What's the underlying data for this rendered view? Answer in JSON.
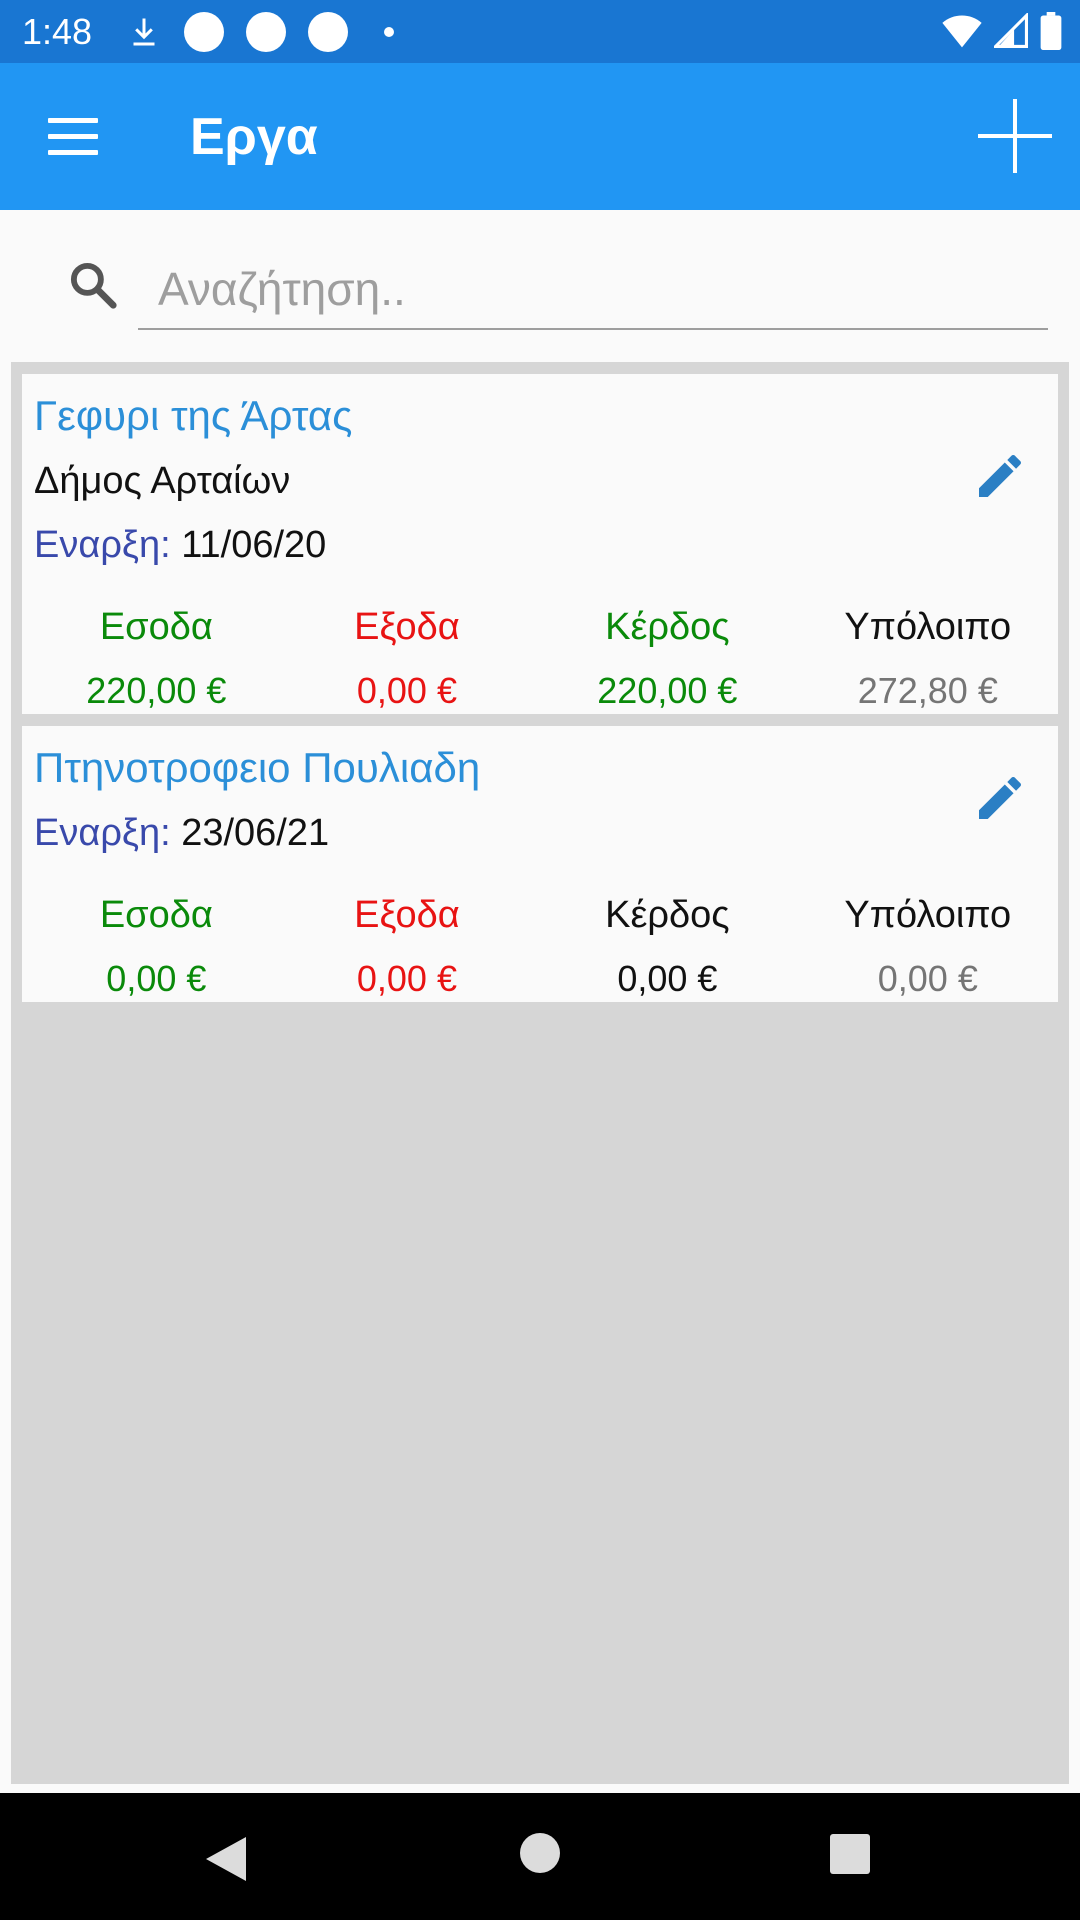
{
  "status_bar": {
    "time": "1:48"
  },
  "app_bar": {
    "title": "Εργα"
  },
  "search": {
    "placeholder": "Αναζήτηση.."
  },
  "projects": [
    {
      "title": "Γεφυρι της Άρτας",
      "client": "Δήμος Αρταίων",
      "start_label": "Εναρξη:",
      "start_date": "11/06/20",
      "stats": [
        {
          "label": "Εσοδα",
          "value": "220,00 €",
          "color": "#0a8a0a"
        },
        {
          "label": "Εξοδα",
          "value": "0,00 €",
          "color": "#e81313"
        },
        {
          "label": "Κέρδος",
          "value": "220,00 €",
          "color": "#0a8a0a"
        },
        {
          "label": "Υπόλοιπο",
          "value": "272,80 €",
          "color": "#757575"
        }
      ]
    },
    {
      "title": "Πτηνοτροφειο Πουλιαδη",
      "start_label": "Εναρξη:",
      "start_date": "23/06/21",
      "stats": [
        {
          "label": "Εσοδα",
          "value": "0,00 €",
          "color": "#0a8a0a"
        },
        {
          "label": "Εξοδα",
          "value": "0,00 €",
          "color": "#e81313"
        },
        {
          "label": "Κέρδος",
          "value": "0,00 €",
          "color": "#111111"
        },
        {
          "label": "Υπόλοιπο",
          "value": "0,00 €",
          "color": "#757575"
        }
      ]
    }
  ],
  "colors": {
    "status_bar": "#1976d2",
    "app_bar": "#2196f3",
    "title_blue": "#2b8fd8",
    "label_indigo": "#3949ab"
  }
}
